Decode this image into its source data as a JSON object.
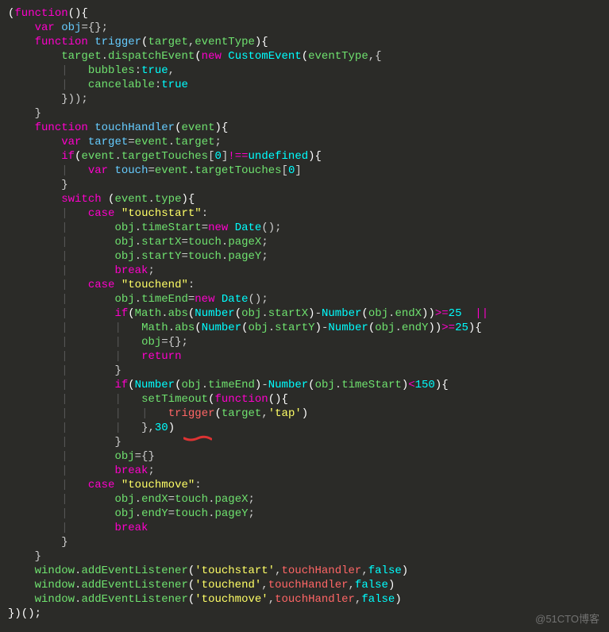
{
  "code": {
    "l01": {
      "p": "(",
      "k1": "function",
      "r": "(){"
    },
    "l02": {
      "k1": "var",
      "v1": "obj",
      "r": "={};"
    },
    "l03": {
      "k1": "function",
      "f": "trigger",
      "p1": "(",
      "a1": "target",
      "c": ",",
      "a2": "eventType",
      "p2": "){"
    },
    "l04": {
      "id1": "target",
      "d": ".",
      "m": "dispatchEvent",
      "p1": "(",
      "k": "new",
      "t": "CustomEvent",
      "p2": "(",
      "a": "eventType",
      "c": ",{"
    },
    "l05": {
      "id": "bubbles",
      "c": ":",
      "v": "true",
      "r": ","
    },
    "l06": {
      "id": "cancelable",
      "c": ":",
      "v": "true"
    },
    "l07": {
      "r": "}));"
    },
    "l08": {
      "r": "}"
    },
    "l09": {
      "k1": "function",
      "f": "touchHandler",
      "p1": "(",
      "a": "event",
      "p2": "){"
    },
    "l10": {
      "k1": "var",
      "v1": "target",
      "eq": "=",
      "o": "event",
      "d": ".",
      "m": "target",
      "r": ";"
    },
    "l11": {
      "k": "if",
      "p1": "(",
      "o": "event",
      "d": ".",
      "m": "targetTouches",
      "br": "[",
      "n": "0",
      "br2": "]",
      "op": "!==",
      "u": "undefined",
      "p2": "){"
    },
    "l12": {
      "k1": "var",
      "v1": "touch",
      "eq": "=",
      "o": "event",
      "d": ".",
      "m": "targetTouches",
      "br": "[",
      "n": "0",
      "br2": "]"
    },
    "l13": {
      "r": "}"
    },
    "l14": {
      "k": "switch",
      "p1": " (",
      "o": "event",
      "d": ".",
      "m": "type",
      "p2": "){"
    },
    "l15": {
      "k": "case",
      "s": "\"touchstart\"",
      "c": ":"
    },
    "l16": {
      "o": "obj",
      "d": ".",
      "m": "timeStart",
      "eq": "=",
      "k": "new",
      "t": "Date",
      "r": "();"
    },
    "l17": {
      "o": "obj",
      "d": ".",
      "m": "startX",
      "eq": "=",
      "o2": "touch",
      "d2": ".",
      "m2": "pageX",
      "r": ";"
    },
    "l18": {
      "o": "obj",
      "d": ".",
      "m": "startY",
      "eq": "=",
      "o2": "touch",
      "d2": ".",
      "m2": "pageY",
      "r": ";"
    },
    "l19": {
      "k": "break",
      "r": ";"
    },
    "l20": {
      "k": "case",
      "s": "\"touchend\"",
      "c": ":"
    },
    "l21": {
      "o": "obj",
      "d": ".",
      "m": "timeEnd",
      "eq": "=",
      "k": "new",
      "t": "Date",
      "r": "();"
    },
    "l22_pre": "if(Math.abs(Number(obj.startX)-Number(obj.endX))>=25  ||",
    "l22": {
      "k": "if",
      "p": "(",
      "fn1": "Math",
      "d1": ".",
      "m1": "abs",
      "p2": "(",
      "fn2": "Number",
      "p3": "(",
      "o1": "obj",
      "d2": ".",
      "m2": "startX",
      "p4": ")",
      "op1": "-",
      "fn3": "Number",
      "p5": "(",
      "o2": "obj",
      "d3": ".",
      "m3": "endX",
      "p6": "))",
      "op2": ">=",
      "n1": "25",
      "sp": "  ",
      "op3": "||"
    },
    "l23": {
      "fn1": "Math",
      "d1": ".",
      "m1": "abs",
      "p2": "(",
      "fn2": "Number",
      "p3": "(",
      "o1": "obj",
      "d2": ".",
      "m2": "startY",
      "p4": ")",
      "op1": "-",
      "fn3": "Number",
      "p5": "(",
      "o2": "obj",
      "d3": ".",
      "m3": "endY",
      "p6": "))",
      "op2": ">=",
      "n1": "25",
      "p7": "){"
    },
    "l24": {
      "o": "obj",
      "r": "={};"
    },
    "l25": {
      "k": "return"
    },
    "l26": {
      "r": "}"
    },
    "l27": {
      "k": "if",
      "p": "(",
      "fn1": "Number",
      "p2": "(",
      "o1": "obj",
      "d1": ".",
      "m1": "timeEnd",
      "p3": ")",
      "op1": "-",
      "fn2": "Number",
      "p4": "(",
      "o2": "obj",
      "d2": ".",
      "m2": "timeStart",
      "p5": ")",
      "op2": "<",
      "n": "150",
      "p6": "){"
    },
    "l28": {
      "fn": "setTimeout",
      "p": "(",
      "k": "function",
      "r": "(){"
    },
    "l29": {
      "fn": "trigger",
      "p": "(",
      "a1": "target",
      "c": ",",
      "s": "'tap'",
      "p2": ")"
    },
    "l30": {
      "r": "},",
      "n": "30",
      "p": ")"
    },
    "l31": {
      "r": "}"
    },
    "l32": {
      "o": "obj",
      "r": "={}"
    },
    "l33": {
      "k": "break",
      "r": ";"
    },
    "l34": {
      "k": "case",
      "s": "\"touchmove\"",
      "c": ":"
    },
    "l35": {
      "o": "obj",
      "d": ".",
      "m": "endX",
      "eq": "=",
      "o2": "touch",
      "d2": ".",
      "m2": "pageX",
      "r": ";"
    },
    "l36": {
      "o": "obj",
      "d": ".",
      "m": "endY",
      "eq": "=",
      "o2": "touch",
      "d2": ".",
      "m2": "pageY",
      "r": ";"
    },
    "l37": {
      "k": "break"
    },
    "l38": {
      "r": "}"
    },
    "l39": {
      "r": "}"
    },
    "l40": {
      "o": "window",
      "d": ".",
      "m": "addEventListener",
      "p": "(",
      "s": "'touchstart'",
      "c": ",",
      "fn": "touchHandler",
      "c2": ",",
      "b": "false",
      "p2": ")"
    },
    "l41": {
      "o": "window",
      "d": ".",
      "m": "addEventListener",
      "p": "(",
      "s": "'touchend'",
      "c": ",",
      "fn": "touchHandler",
      "c2": ",",
      "b": "false",
      "p2": ")"
    },
    "l42": {
      "o": "window",
      "d": ".",
      "m": "addEventListener",
      "p": "(",
      "s": "'touchmove'",
      "c": ",",
      "fn": "touchHandler",
      "c2": ",",
      "b": "false",
      "p2": ")"
    },
    "l43": {
      "r": "})();"
    }
  },
  "watermark": "@51CTO博客"
}
